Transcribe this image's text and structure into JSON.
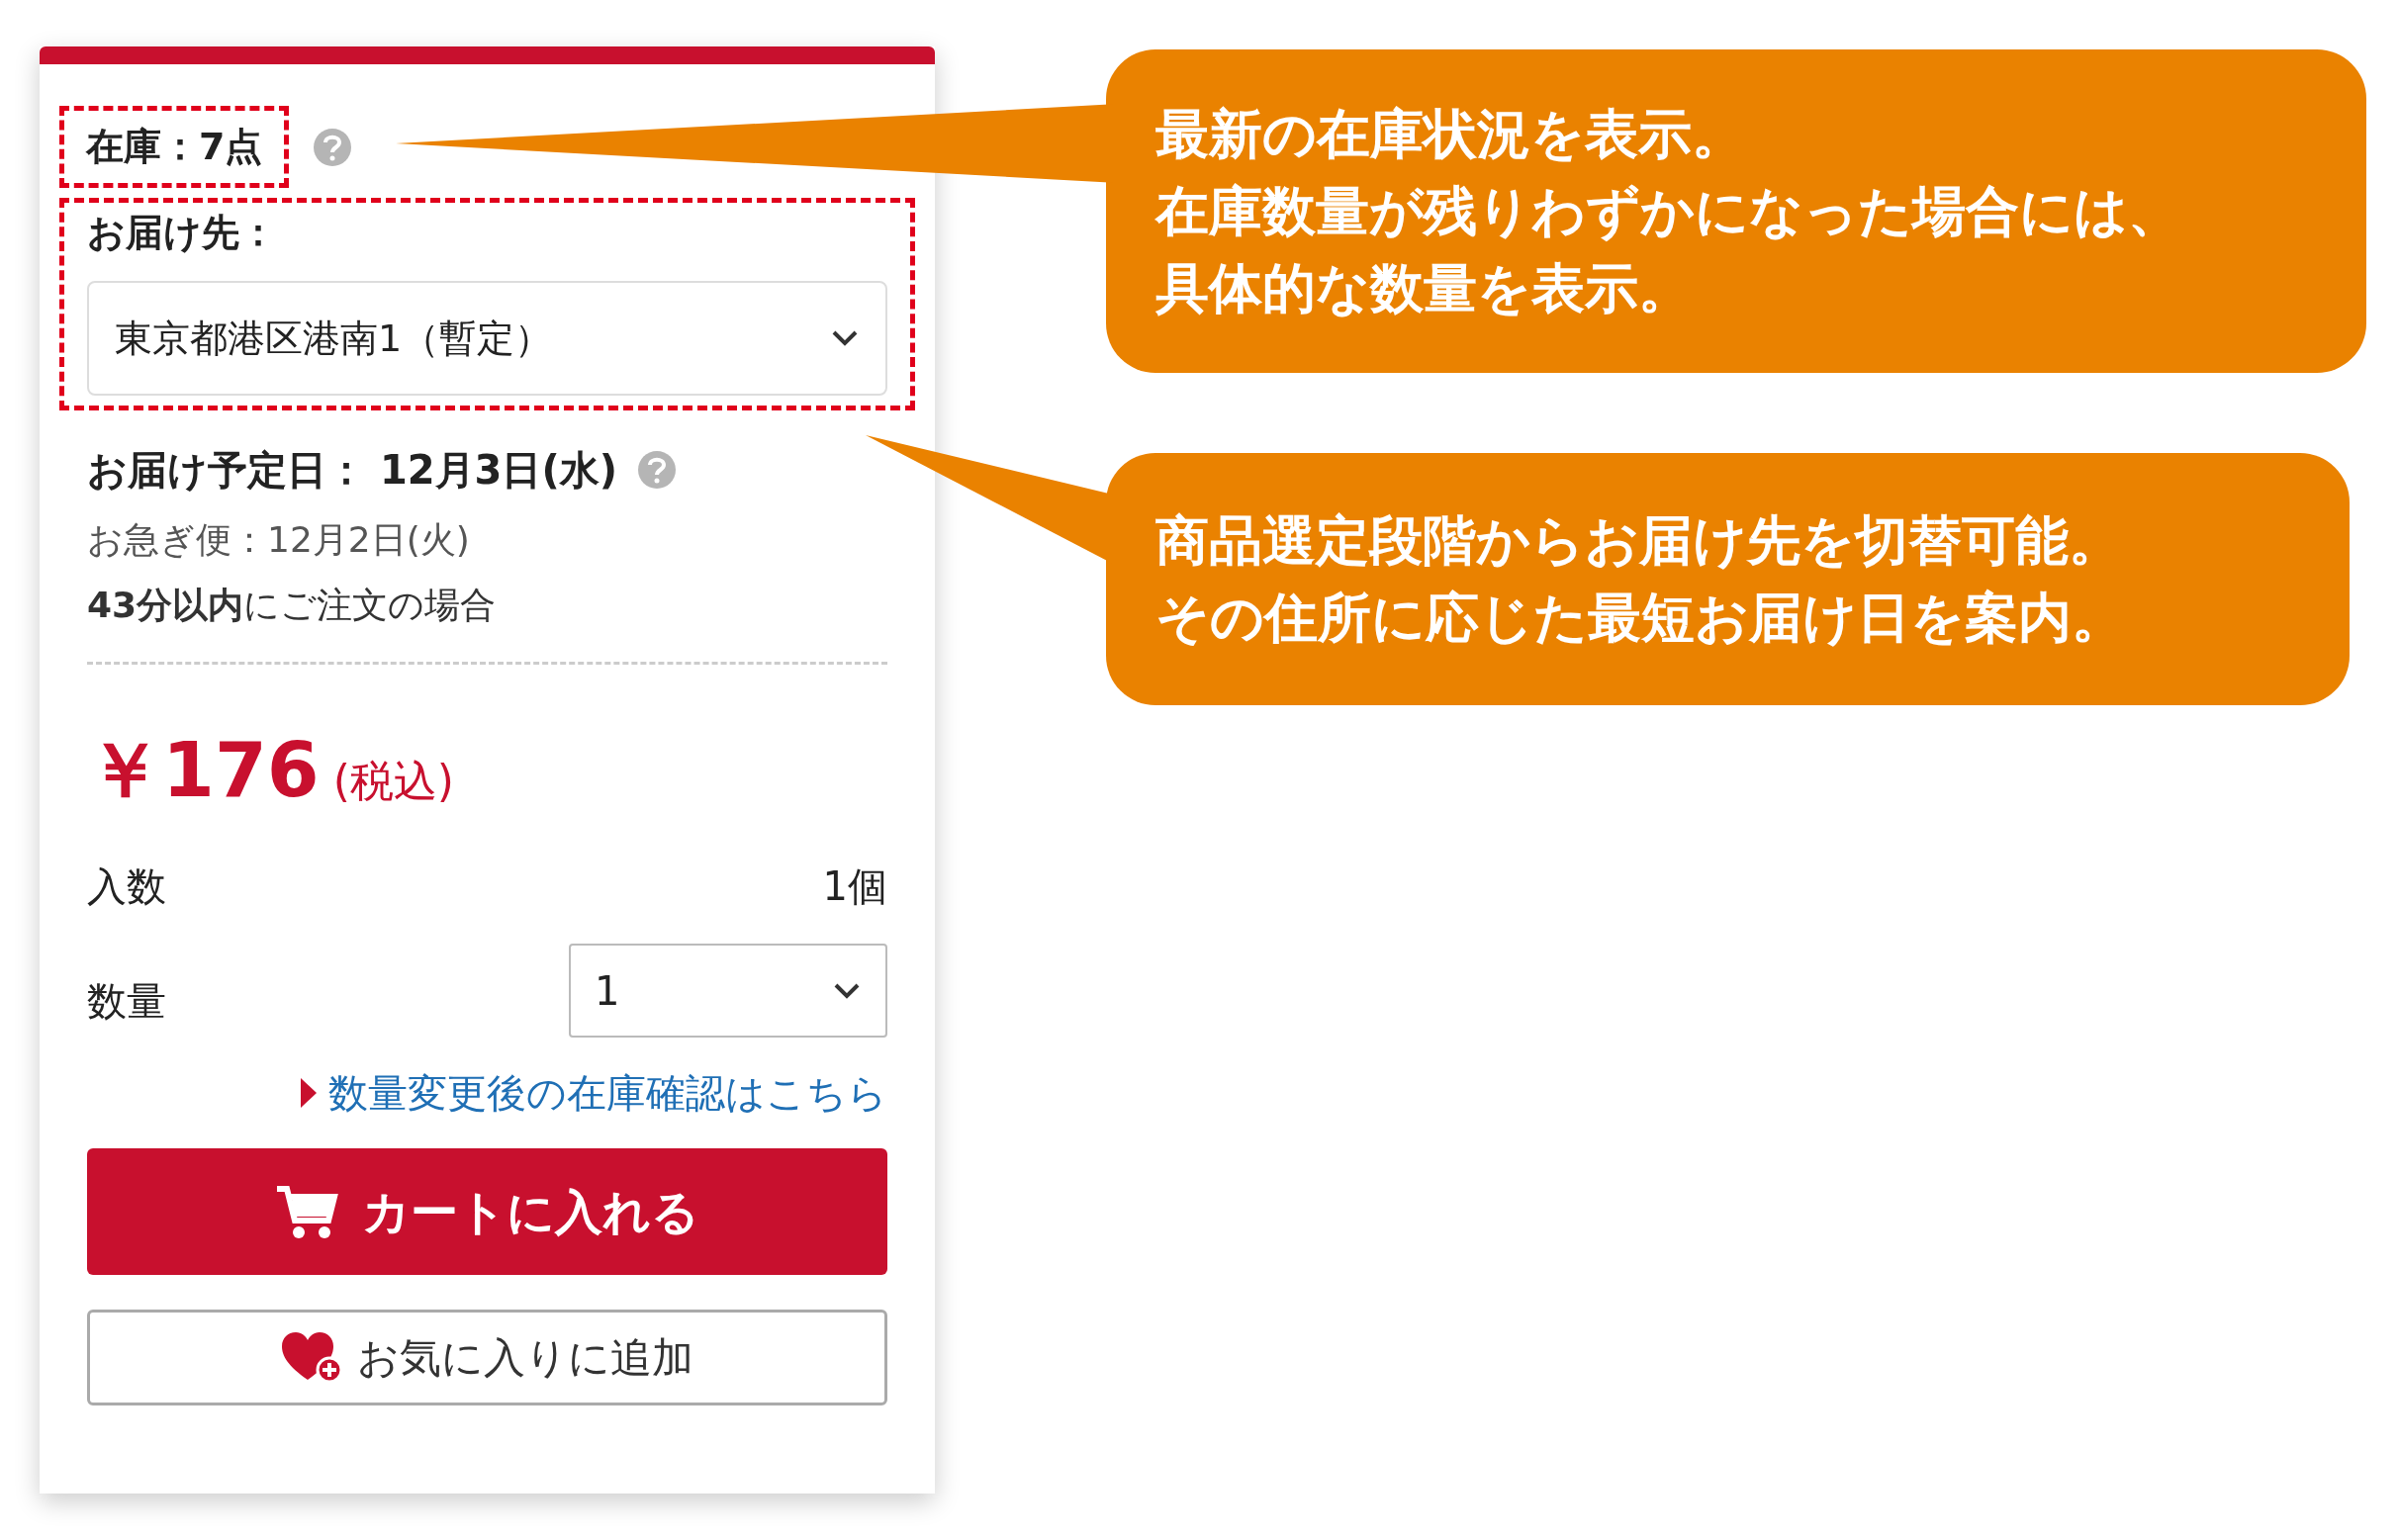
{
  "stock": {
    "label": "在庫：7点"
  },
  "destination": {
    "label": "お届け先：",
    "address": "東京都港区港南1（暫定）"
  },
  "delivery": {
    "scheduled": "お届け予定日： 12月3日(水)",
    "express": "お急ぎ便：12月2日(火)",
    "deadline": "**43分以内**にご注文の場合"
  },
  "price": {
    "amount": "￥176",
    "tax": "(税込)"
  },
  "contents": {
    "label": "入数",
    "value": "1個"
  },
  "quantity": {
    "label": "数量",
    "value": "1"
  },
  "stock_check_link": "数量変更後の在庫確認はこちら",
  "buttons": {
    "cart": "カートに入れる",
    "favorite": "お気に入りに追加"
  },
  "callouts": [
    {
      "lines": [
        "最新の在庫状況を表示。",
        "在庫数量が残りわずかになった場合には、",
        "具体的な数量を表示。"
      ]
    },
    {
      "lines": [
        "商品選定段階からお届け先を切替可能。",
        "その住所に応じた最短お届け日を案内。"
      ]
    }
  ]
}
